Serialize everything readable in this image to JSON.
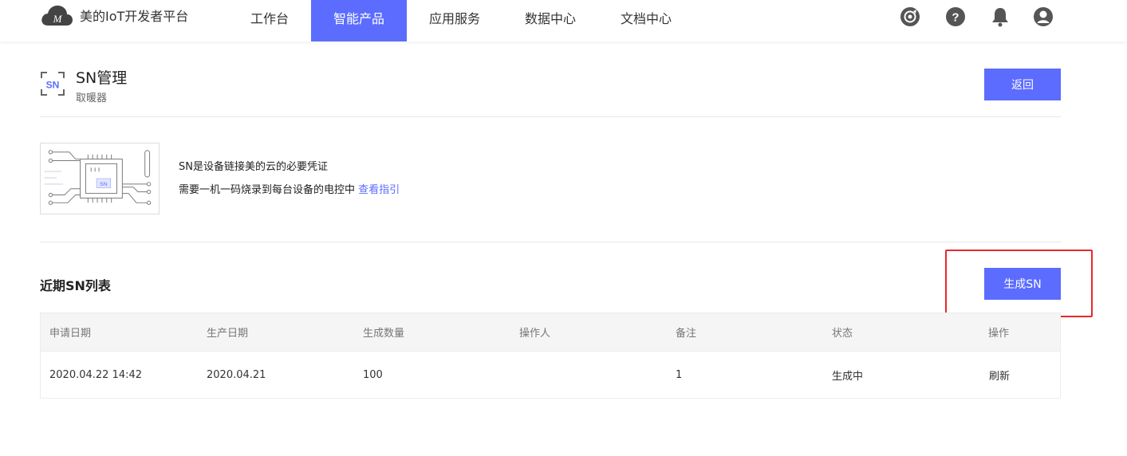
{
  "app": {
    "logo_text": "美的IoT开发者平台"
  },
  "nav": {
    "items": [
      {
        "label": "工作台",
        "active": false
      },
      {
        "label": "智能产品",
        "active": true
      },
      {
        "label": "应用服务",
        "active": false
      },
      {
        "label": "数据中心",
        "active": false
      },
      {
        "label": "文档中心",
        "active": false
      }
    ],
    "icons": [
      "target-icon",
      "help-icon",
      "bell-icon",
      "user-icon"
    ],
    "accent_color": "#5b6cff"
  },
  "header": {
    "icon_text": "SN",
    "title": "SN管理",
    "subtitle": "取暖器",
    "back_label": "返回"
  },
  "info": {
    "illustration_chip_label": "SN",
    "line1": "SN是设备链接美的云的必要凭证",
    "line2": "需要一机一码烧录到每台设备的电控中",
    "link_text": "查看指引"
  },
  "list": {
    "title": "近期SN列表",
    "generate_label": "生成SN",
    "highlight_color": "#e8282b",
    "columns": [
      "申请日期",
      "生产日期",
      "生成数量",
      "操作人",
      "备注",
      "状态",
      "操作"
    ],
    "rows": [
      {
        "apply_date": "2020.04.22 14:42",
        "production_date": "2020.04.21",
        "quantity": "100",
        "operator": "",
        "remark": "1",
        "status": "生成中",
        "action": "刷新"
      }
    ]
  }
}
